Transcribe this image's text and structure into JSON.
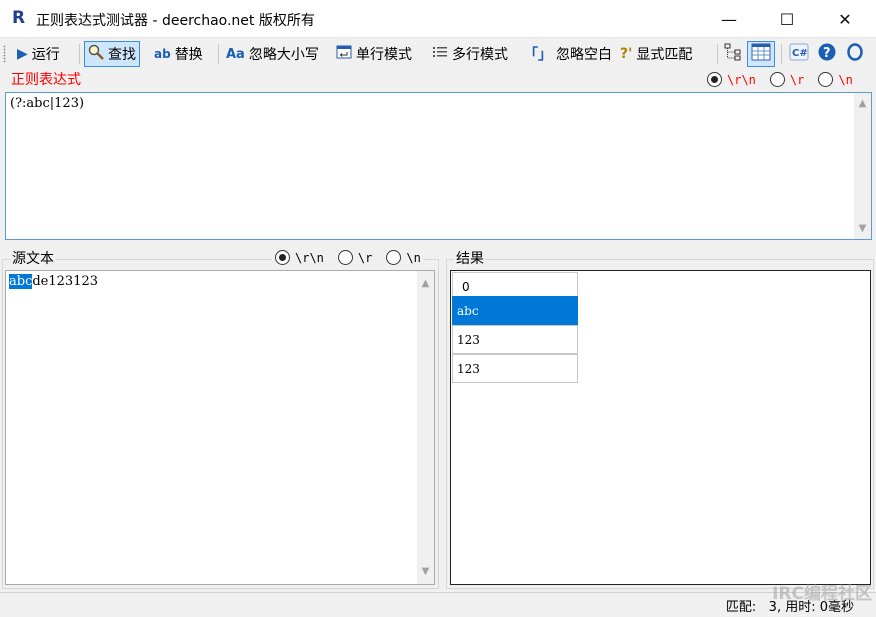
{
  "window": {
    "title": "正则表达式测试器 - deerchao.net 版权所有",
    "icon_text": "R",
    "minimize": "—",
    "maximize": "☐",
    "close": "✕"
  },
  "toolbar": {
    "run": "运行",
    "find": "查找",
    "replace": "替换",
    "ignore_case": "忽略大小写",
    "single_line": "单行模式",
    "multi_line": "多行模式",
    "ignore_whitespace": "忽略空白",
    "explicit_capture": "显式匹配",
    "ignore_whitespace_glyph": "「」",
    "explicit_capture_glyph": "?'"
  },
  "regex": {
    "label": "正则表达式",
    "value": "(?:abc|123)",
    "newline_options": [
      "\\r\\n",
      "\\r",
      "\\n"
    ],
    "selected_option": 0,
    "label_color": "#ff0000"
  },
  "source": {
    "label": "源文本",
    "highlighted": "abc",
    "rest": "de123123",
    "newline_options": [
      "\\r\\n",
      "\\r",
      "\\n"
    ],
    "selected_option": 0
  },
  "results": {
    "label": "结果",
    "rows": [
      "0",
      "abc",
      "123",
      "123"
    ],
    "selected_row": 1
  },
  "status": {
    "text": "匹配:   3, 用时: 0毫秒"
  },
  "watermark": "IRC编程社区",
  "colors": {
    "accent": "#0078d7",
    "regex_border": "#5b9bd5"
  }
}
